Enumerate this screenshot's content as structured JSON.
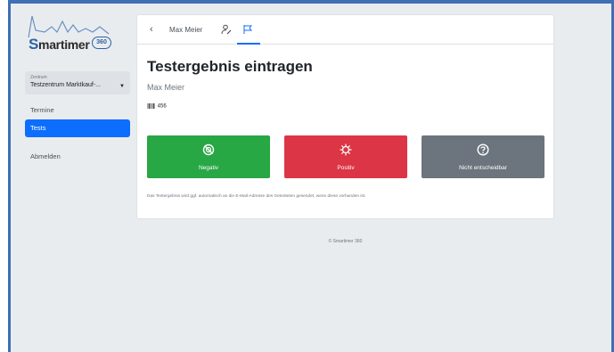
{
  "brand": {
    "name": "Smartimer",
    "badge": "360",
    "color": "#2d62a8"
  },
  "sidebar": {
    "zentrum_label": "Zentrum",
    "zentrum_value": "Testzentrum Marktkauf-...",
    "items": [
      {
        "label": "Termine",
        "active": false
      },
      {
        "label": "Tests",
        "active": true
      },
      {
        "label": "Abmelden",
        "active": false
      }
    ]
  },
  "topnav": {
    "back_icon": "chevron-left-icon",
    "person_name": "Max Meier",
    "person_icon": "person-edit-icon",
    "flag_icon": "flag-icon",
    "active_tab": "flag"
  },
  "main": {
    "title": "Testergebnis eintragen",
    "subtitle": "Max Meier",
    "id_value": "456",
    "buttons": [
      {
        "label": "Negativ",
        "icon": "virus-slash-icon",
        "color": "#28a745"
      },
      {
        "label": "Positiv",
        "icon": "virus-icon",
        "color": "#dc3545"
      },
      {
        "label": "Nicht entscheidbar",
        "icon": "question-circle-icon",
        "color": "#6c757d"
      }
    ],
    "note": "Das Testergebnis wird ggf. automatisch an die E-Mail-Adresse des Getesteten gesendet, wenn diese vorhanden ist."
  },
  "footer": "© Smartimer 360"
}
